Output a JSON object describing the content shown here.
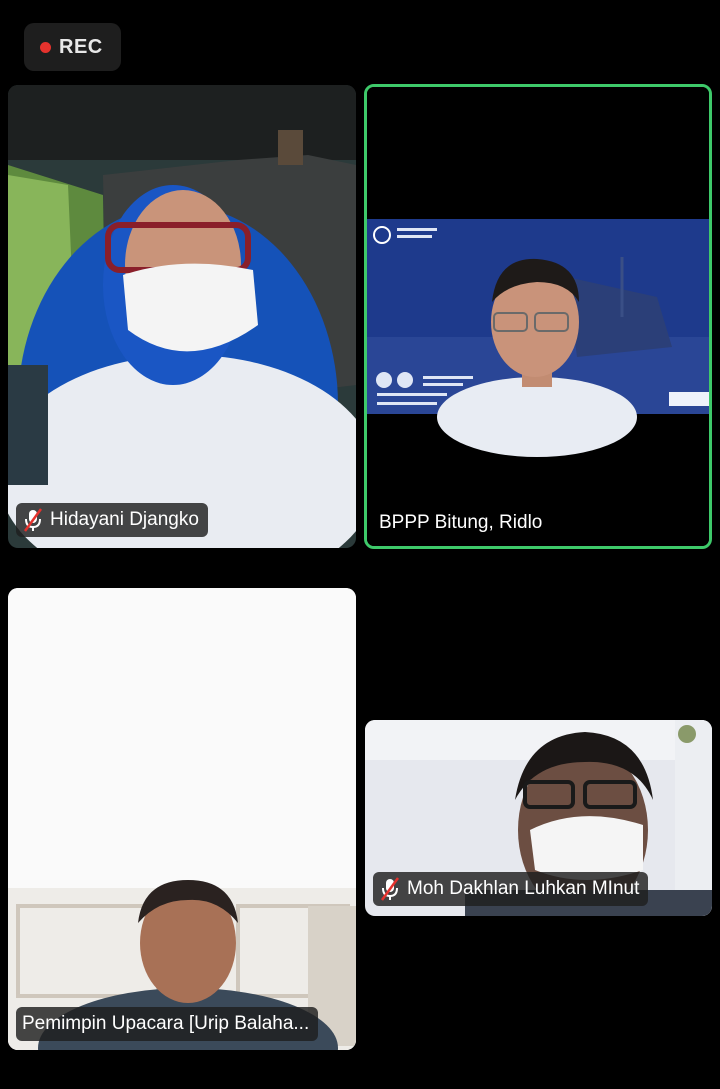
{
  "recording": {
    "label": "REC",
    "color": "#e5322d"
  },
  "active_speaker_border": "#3ec96a",
  "participants": [
    {
      "name": "Hidayani Djangko",
      "muted": true
    },
    {
      "name": "BPPP Bitung, Ridlo",
      "muted": false,
      "active_speaker": true
    },
    {
      "name": "Pemimpin Upacara [Urip Balaha...",
      "muted": false
    },
    {
      "name": "Moh Dakhlan Luhkan MInut",
      "muted": true
    }
  ]
}
